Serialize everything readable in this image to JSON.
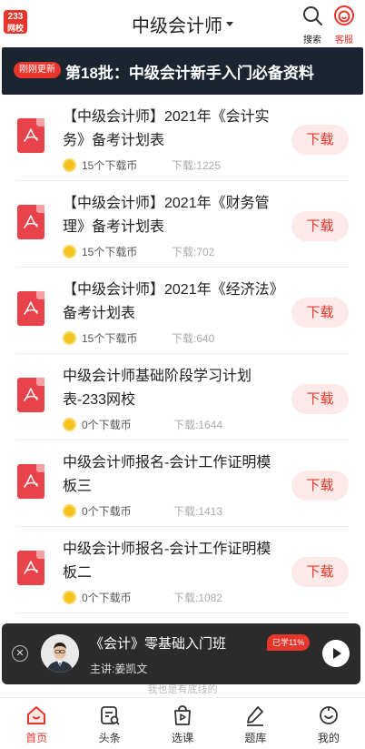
{
  "header": {
    "logo_line1": "233",
    "logo_line2": "网校",
    "title": "中级会计师",
    "search_label": "搜索",
    "service_label": "客服"
  },
  "banner": {
    "badge": "刚刚更新",
    "text": "第18批：中级会计新手入门必备资料"
  },
  "downloads": [
    {
      "title": "【中级会计师】2021年《会计实务》备考计划表",
      "coins": "15个下载币",
      "count": "下载:1225",
      "button": "下载"
    },
    {
      "title": "【中级会计师】2021年《财务管理》备考计划表",
      "coins": "15个下载币",
      "count": "下载:702",
      "button": "下载"
    },
    {
      "title": "【中级会计师】2021年《经济法》备考计划表",
      "coins": "15个下载币",
      "count": "下载:640",
      "button": "下载"
    },
    {
      "title": "中级会计师基础阶段学习计划表-233网校",
      "coins": "0个下载币",
      "count": "下载:1644",
      "button": "下载"
    },
    {
      "title": "中级会计师报名-会计工作证明模板三",
      "coins": "0个下载币",
      "count": "下载:1413",
      "button": "下载"
    },
    {
      "title": "中级会计师报名-会计工作证明模板二",
      "coins": "0个下载币",
      "count": "下载:1082",
      "button": "下载"
    }
  ],
  "course": {
    "title": "《会计》零基础入门班",
    "teacher": "主讲:姜凯文",
    "progress": "已学11%"
  },
  "footer_hint": "我也是有底线的",
  "bottom_nav": [
    {
      "label": "首页",
      "icon": "home-icon"
    },
    {
      "label": "头条",
      "icon": "headlines-icon"
    },
    {
      "label": "选课",
      "icon": "course-bag-icon"
    },
    {
      "label": "题库",
      "icon": "pen-icon"
    },
    {
      "label": "我的",
      "icon": "profile-icon"
    }
  ],
  "colors": {
    "accent": "#e8352b",
    "banner_bg": "#1b2530",
    "button_bg": "#fde9e7"
  }
}
